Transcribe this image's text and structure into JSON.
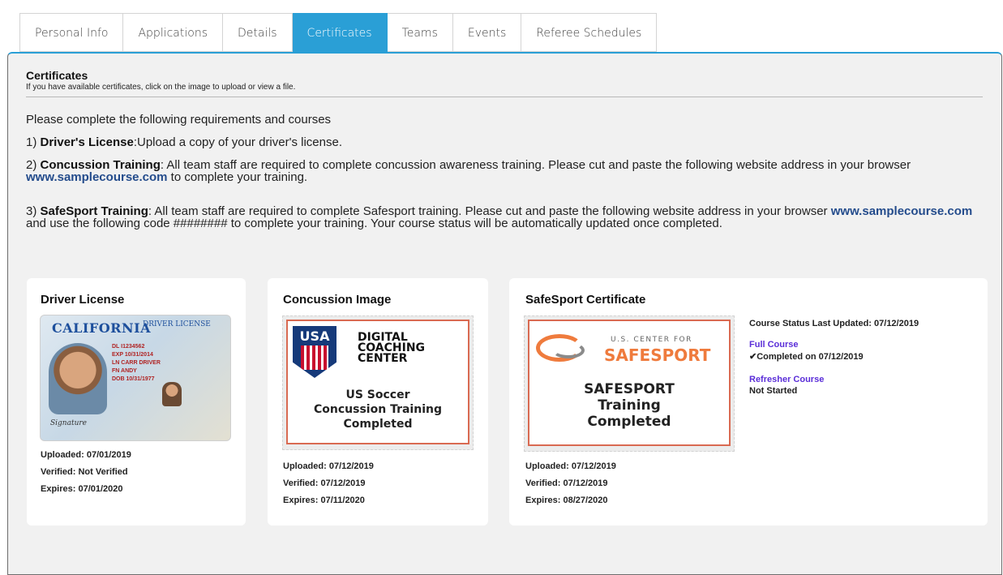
{
  "tabs": [
    {
      "label": "Personal Info"
    },
    {
      "label": "Applications"
    },
    {
      "label": "Details"
    },
    {
      "label": "Certificates",
      "active": true
    },
    {
      "label": "Teams"
    },
    {
      "label": "Events"
    },
    {
      "label": "Referee Schedules"
    }
  ],
  "section": {
    "title": "Certificates",
    "subtitle": "If you have available certificates, click on the image to upload or view a file."
  },
  "instructions": {
    "intro": "Please complete the following requirements and courses",
    "item1": {
      "num": "1)",
      "title": "Driver's License",
      "text": ":Upload a copy of your driver's license."
    },
    "item2": {
      "num": "2)",
      "title": "Concussion Training",
      "text1": ": All team staff are required to complete concussion awareness training. Please cut and paste the following website address in your browser ",
      "link": "www.samplecourse.com",
      "text2": " to complete your training."
    },
    "item3": {
      "num": "3)",
      "title": "SafeSport Training",
      "text1": ": All team staff are required to complete Safesport training. Please cut and paste the following website address in your browser ",
      "link": "www.samplecourse.com",
      "text2": " and use the following code ######## to complete your training. Your course status will be automatically updated once completed."
    }
  },
  "cards": {
    "license": {
      "title": "Driver License",
      "image": {
        "state": "CALIFORNIA",
        "tag": "DRIVER LICENSE",
        "dl": "DL I1234562",
        "exp": "EXP 10/31/2014",
        "ln": "LN CARR DRIVER",
        "fn": "FN ANDY",
        "dob": "DOB 10/31/1977",
        "sig": "Signature"
      },
      "uploaded": "Uploaded: 07/01/2019",
      "verified": "Verified: Not Verified",
      "expires": "Expires: 07/01/2020"
    },
    "concussion": {
      "title": "Concussion Image",
      "image": {
        "usa": "USA",
        "dcc1": "DIGITAL",
        "dcc2": "COACHING",
        "dcc3": "CENTER",
        "line1": "US Soccer",
        "line2": "Concussion Training",
        "line3": "Completed"
      },
      "uploaded": "Uploaded: 07/12/2019",
      "verified": "Verified: 07/12/2019",
      "expires": "Expires: 07/11/2020"
    },
    "safesport": {
      "title": "SafeSport Certificate",
      "image": {
        "center": "U.S. CENTER FOR",
        "brand": "SAFESPORT",
        "line1": "SAFESPORT",
        "line2": "Training",
        "line3": "Completed"
      },
      "uploaded": "Uploaded: 07/12/2019",
      "verified": "Verified: 07/12/2019",
      "expires": "Expires: 08/27/2020",
      "status_updated": "Course Status Last Updated: 07/12/2019",
      "full_course_label": "Full Course",
      "full_course_status": "✔Completed on 07/12/2019",
      "refresher_label": "Refresher Course",
      "refresher_status": "Not Started"
    }
  }
}
